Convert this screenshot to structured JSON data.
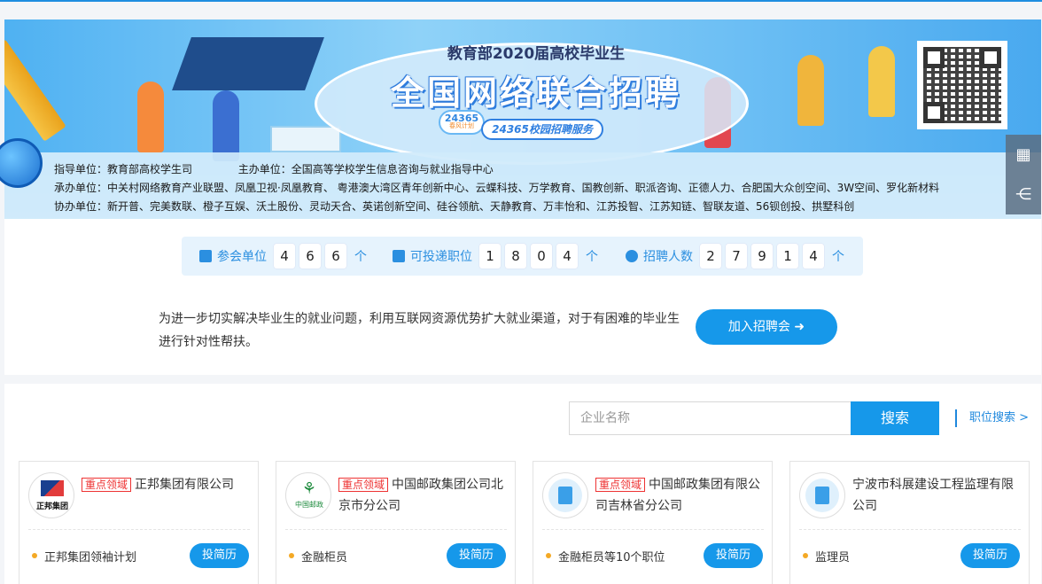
{
  "banner": {
    "subtitle": "教育部2020届高校毕业生",
    "title": "全国网络联合招聘",
    "badge_num": "24365",
    "badge_text": "春风计划",
    "pill": "24365校园招聘服务"
  },
  "info": {
    "guide_label": "指导单位：",
    "guide": "教育部高校学生司",
    "host_label": "主办单位：",
    "host": "全国高等学校学生信息咨询与就业指导中心",
    "organizer_label": "承办单位：",
    "organizers": "中关村网络教育产业联盟、凤凰卫视·凤凰教育、 粤港澳大湾区青年创新中心、云蝶科技、万学教育、国教创新、职派咨询、正德人力、合肥国大众创空间、3W空间、罗化新材料",
    "assist_label": "协办单位：",
    "assistants": "新开普、完美数联、橙子互娱、沃土股份、灵动天合、英诺创新空间、硅谷领航、天静教育、万丰怡和、江苏投智、江苏知链、智联友道、56钡创投、拱墅科创"
  },
  "stats": {
    "companies": {
      "label": "参会单位",
      "digits": [
        "4",
        "6",
        "6"
      ],
      "unit": "个"
    },
    "positions": {
      "label": "可投递职位",
      "digits": [
        "1",
        "8",
        "0",
        "4"
      ],
      "unit": "个"
    },
    "hires": {
      "label": "招聘人数",
      "digits": [
        "2",
        "7",
        "9",
        "1",
        "4"
      ],
      "unit": "个"
    }
  },
  "intro": {
    "text": "为进一步切实解决毕业生的就业问题，利用互联网资源优势扩大就业渠道，对于有困难的毕业生进行针对性帮扶。",
    "join_label": "加入招聘会 ➜"
  },
  "search": {
    "placeholder": "企业名称",
    "button": "搜索",
    "position_search": "职位搜索 >"
  },
  "cards": [
    {
      "tag": "重点领域",
      "name": "正邦集团有限公司",
      "job": "正邦集团领袖计划",
      "apply": "投简历",
      "logo_text": "正邦集团"
    },
    {
      "tag": "重点领域",
      "name": "中国邮政集团公司北京市分公司",
      "job": "金融柜员",
      "apply": "投简历",
      "logo_text": "中国邮政"
    },
    {
      "tag": "重点领域",
      "name": "中国邮政集团有限公司吉林省分公司",
      "job": "金融柜员等10个职位",
      "apply": "投简历"
    },
    {
      "tag": "",
      "name": "宁波市科展建设工程监理有限公司",
      "job": "监理员",
      "apply": "投简历"
    }
  ],
  "colors": {
    "accent": "#1698ea",
    "tag_red": "#e33333",
    "bullet": "#f4a925"
  }
}
